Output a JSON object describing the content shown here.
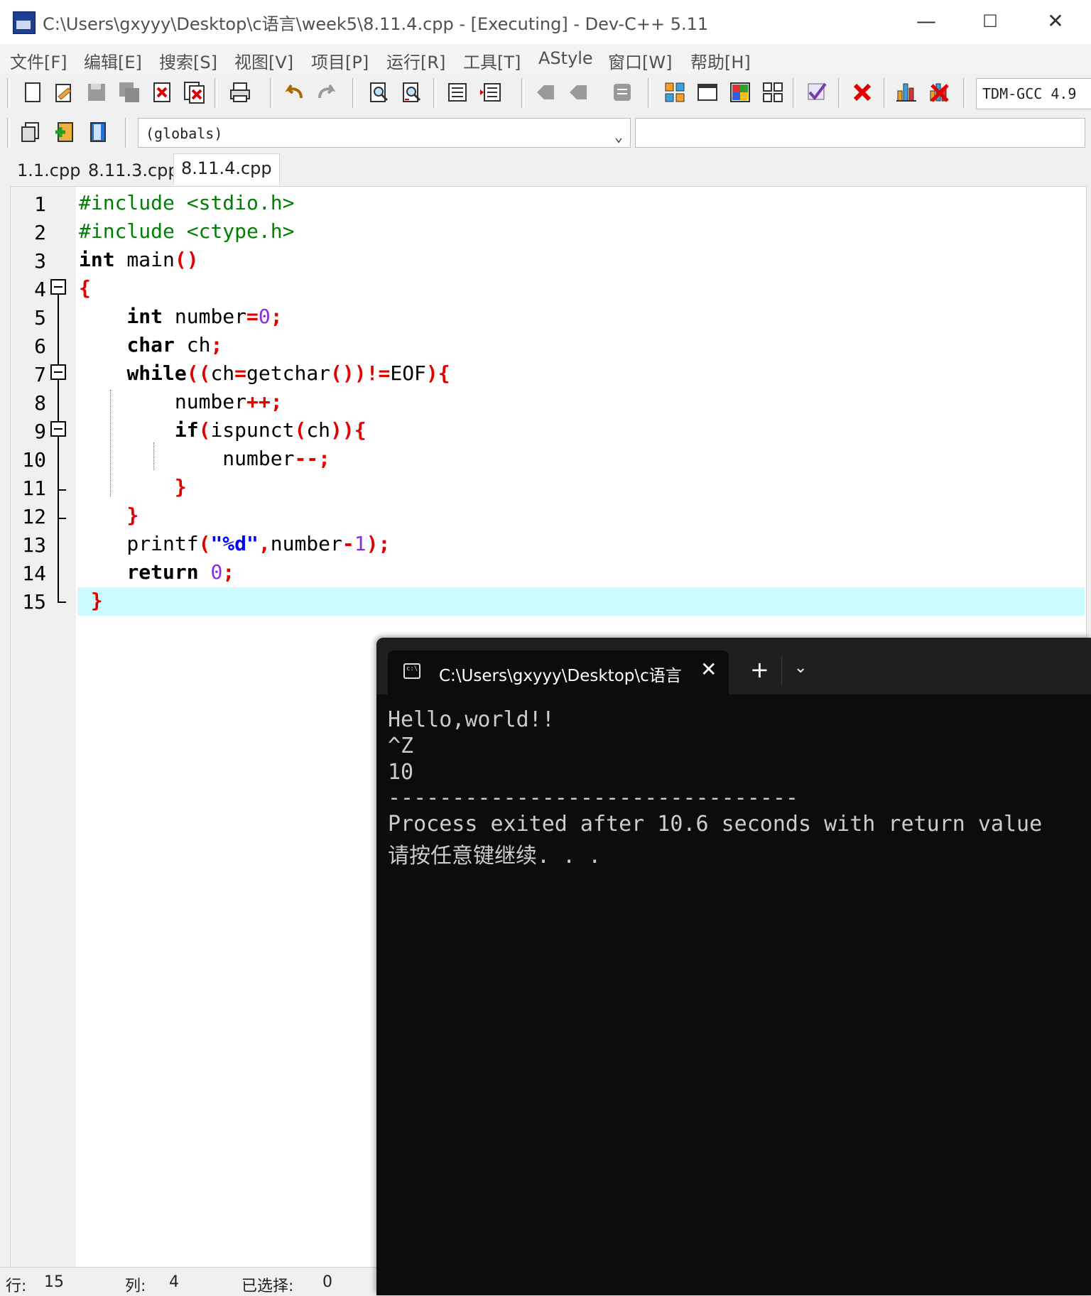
{
  "window": {
    "title": "C:\\Users\\gxyyy\\Desktop\\c语言\\week5\\8.11.4.cpp - [Executing] - Dev-C++ 5.11",
    "minimize": "—",
    "maximize": "☐",
    "close": "✕"
  },
  "menu": [
    "文件[F]",
    "编辑[E]",
    "搜索[S]",
    "视图[V]",
    "项目[P]",
    "运行[R]",
    "工具[T]",
    "AStyle",
    "窗口[W]",
    "帮助[H]"
  ],
  "toolbar": {
    "compiler": "TDM-GCC 4.9",
    "scope_combo": "(globals)"
  },
  "tabs": [
    "1.1.cpp",
    "8.11.3.cpp",
    "8.11.4.cpp"
  ],
  "active_tab": "8.11.4.cpp",
  "editor": {
    "line_numbers": [
      "1",
      "2",
      "3",
      "4",
      "5",
      "6",
      "7",
      "8",
      "9",
      "10",
      "11",
      "12",
      "13",
      "14",
      "15"
    ],
    "current_line": 15
  },
  "status": {
    "row_label": "行:",
    "row_value": "15",
    "col_label": "列:",
    "col_value": "4",
    "sel_label": "已选择:",
    "sel_value": "0"
  },
  "terminal": {
    "tab_title": "C:\\Users\\gxyyy\\Desktop\\c语言",
    "new_tab": "+",
    "lines": [
      "Hello,world!!",
      "^Z",
      "10",
      "--------------------------------",
      "Process exited after 10.6 seconds with return value",
      "请按任意键继续. . ."
    ]
  }
}
